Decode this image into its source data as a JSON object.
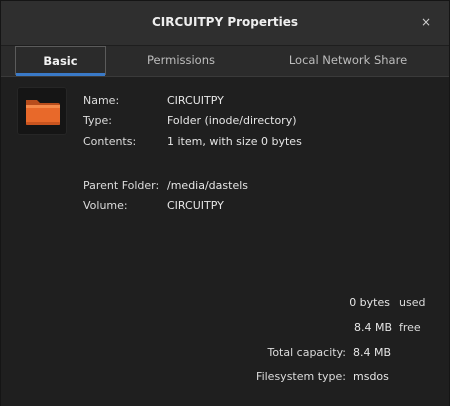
{
  "window": {
    "title": "CIRCUITPY Properties",
    "close_glyph": "×"
  },
  "tabs": [
    {
      "label": "Basic",
      "active": true
    },
    {
      "label": "Permissions",
      "active": false
    },
    {
      "label": "Local Network Share",
      "active": false
    }
  ],
  "basic": {
    "icon": "folder-icon",
    "name_label": "Name:",
    "name_value": "CIRCUITPY",
    "type_label": "Type:",
    "type_value": "Folder (inode/directory)",
    "contents_label": "Contents:",
    "contents_value": "1 item, with size 0 bytes",
    "parent_label": "Parent Folder:",
    "parent_value": "/media/dastels",
    "volume_label": "Volume:",
    "volume_value": "CIRCUITPY"
  },
  "usage": {
    "used_amount": "0 bytes",
    "used_label": "used",
    "free_amount": "8.4 MB",
    "free_label": "free",
    "capacity_label": "Total capacity:",
    "capacity_value": "8.4 MB",
    "fs_label": "Filesystem type:",
    "fs_value": "msdos"
  },
  "colors": {
    "accent": "#3a7ac8",
    "folder_orange": "#e8692a",
    "background": "#1f1f1f"
  }
}
